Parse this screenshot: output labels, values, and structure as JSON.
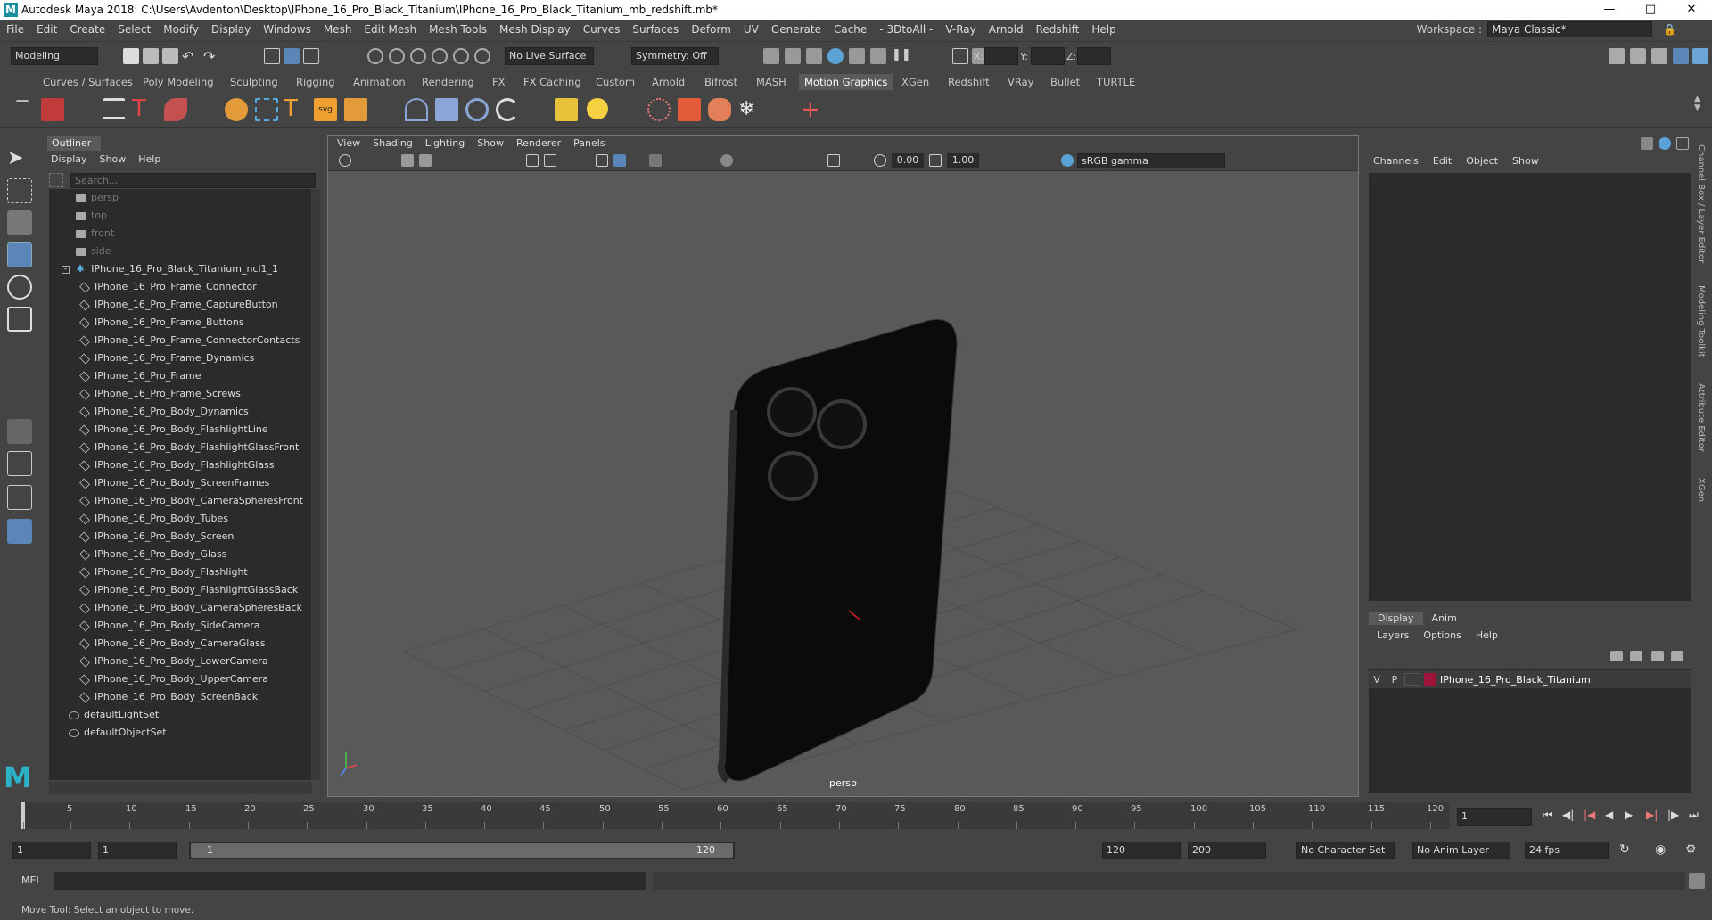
{
  "window": {
    "title": "Autodesk Maya 2018: C:\\Users\\Avdenton\\Desktop\\IPhone_16_Pro_Black_Titanium\\IPhone_16_Pro_Black_Titanium_mb_redshift.mb*",
    "logo": "M"
  },
  "menubar": {
    "items": [
      "File",
      "Edit",
      "Create",
      "Select",
      "Modify",
      "Display",
      "Windows",
      "Mesh",
      "Edit Mesh",
      "Mesh Tools",
      "Mesh Display",
      "Curves",
      "Surfaces",
      "Deform",
      "UV",
      "Generate",
      "Cache",
      "- 3DtoAll -",
      "V-Ray",
      "Arnold",
      "Redshift",
      "Help"
    ],
    "workspace_label": "Workspace :",
    "workspace_value": "Maya Classic*"
  },
  "statusline": {
    "mode": "Modeling",
    "live_surface": "No Live Surface",
    "symmetry": "Symmetry: Off",
    "x_label": "X:",
    "y_label": "Y:",
    "z_label": "Z:"
  },
  "shelf": {
    "tabs": [
      "Curves / Surfaces",
      "Poly Modeling",
      "Sculpting",
      "Rigging",
      "Animation",
      "Rendering",
      "FX",
      "FX Caching",
      "Custom",
      "Arnold",
      "Bifrost",
      "MASH",
      "Motion Graphics",
      "XGen",
      "Redshift",
      "VRay",
      "Bullet",
      "TURTLE"
    ],
    "active_tab": "Motion Graphics"
  },
  "outliner": {
    "title": "Outliner",
    "menu": [
      "Display",
      "Show",
      "Help"
    ],
    "search_placeholder": "Search...",
    "cameras": [
      "persp",
      "top",
      "front",
      "side"
    ],
    "group": "IPhone_16_Pro_Black_Titanium_ncl1_1",
    "children": [
      "IPhone_16_Pro_Frame_Connector",
      "IPhone_16_Pro_Frame_CaptureButton",
      "IPhone_16_Pro_Frame_Buttons",
      "IPhone_16_Pro_Frame_ConnectorContacts",
      "IPhone_16_Pro_Frame_Dynamics",
      "IPhone_16_Pro_Frame",
      "IPhone_16_Pro_Frame_Screws",
      "IPhone_16_Pro_Body_Dynamics",
      "IPhone_16_Pro_Body_FlashlightLine",
      "IPhone_16_Pro_Body_FlashlightGlassFront",
      "IPhone_16_Pro_Body_FlashlightGlass",
      "IPhone_16_Pro_Body_ScreenFrames",
      "IPhone_16_Pro_Body_CameraSpheresFront",
      "IPhone_16_Pro_Body_Tubes",
      "IPhone_16_Pro_Body_Screen",
      "IPhone_16_Pro_Body_Glass",
      "IPhone_16_Pro_Body_Flashlight",
      "IPhone_16_Pro_Body_FlashlightGlassBack",
      "IPhone_16_Pro_Body_CameraSpheresBack",
      "IPhone_16_Pro_Body_SideCamera",
      "IPhone_16_Pro_Body_CameraGlass",
      "IPhone_16_Pro_Body_LowerCamera",
      "IPhone_16_Pro_Body_UpperCamera",
      "IPhone_16_Pro_Body_ScreenBack"
    ],
    "sets": [
      "defaultLightSet",
      "defaultObjectSet"
    ]
  },
  "viewport": {
    "menu": [
      "View",
      "Shading",
      "Lighting",
      "Show",
      "Renderer",
      "Panels"
    ],
    "exposure": "0.00",
    "gamma_value": "1.00",
    "color_space": "sRGB gamma",
    "camera_label": "persp"
  },
  "channelbox": {
    "menu": [
      "Channels",
      "Edit",
      "Object",
      "Show"
    ],
    "tabs": [
      "Display",
      "Anim"
    ],
    "layer_menu": [
      "Layers",
      "Options",
      "Help"
    ],
    "layer": {
      "v": "V",
      "p": "P",
      "name": "IPhone_16_Pro_Black_Titanium",
      "color": "#a0143c"
    },
    "side_tabs": [
      "Channel Box / Layer Editor",
      "Modeling Toolkit",
      "Attribute Editor",
      "XGen"
    ]
  },
  "timeslider": {
    "ticks": [
      "1",
      "5",
      "10",
      "15",
      "20",
      "25",
      "30",
      "35",
      "40",
      "45",
      "50",
      "55",
      "60",
      "65",
      "70",
      "75",
      "80",
      "85",
      "90",
      "95",
      "100",
      "105",
      "110",
      "115",
      "120"
    ],
    "current_frame": "1"
  },
  "rangeslider": {
    "start": "1",
    "playback_start": "1",
    "range_start": "1",
    "range_end": "120",
    "playback_end": "120",
    "end": "200",
    "character_set": "No Character Set",
    "anim_layer": "No Anim Layer",
    "fps": "24 fps"
  },
  "cmdline": {
    "label": "MEL"
  },
  "helpline": {
    "text": "Move Tool: Select an object to move."
  }
}
